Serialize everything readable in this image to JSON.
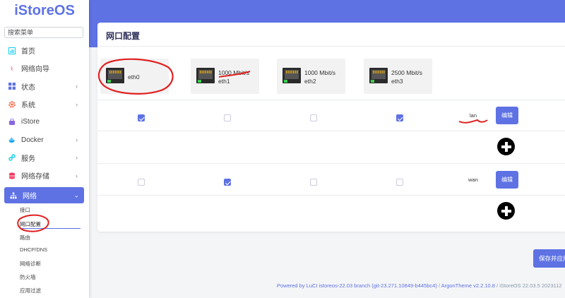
{
  "brand": {
    "title": "iStoreOS",
    "color": "#5e72e4"
  },
  "sidebar": {
    "search_placeholder": "搜索菜单",
    "items": [
      {
        "label": "首页",
        "icon": "chart-icon",
        "has_chevron": false
      },
      {
        "label": "网络向导",
        "icon": "wizard-icon",
        "has_chevron": false
      },
      {
        "label": "状态",
        "icon": "grid-icon",
        "has_chevron": true
      },
      {
        "label": "系统",
        "icon": "gear-icon",
        "has_chevron": true
      },
      {
        "label": "iStore",
        "icon": "store-icon",
        "has_chevron": false
      },
      {
        "label": "Docker",
        "icon": "docker-icon",
        "has_chevron": true
      },
      {
        "label": "服务",
        "icon": "services-icon",
        "has_chevron": true
      },
      {
        "label": "网络存储",
        "icon": "storage-icon",
        "has_chevron": true
      },
      {
        "label": "网络",
        "icon": "network-icon",
        "has_chevron": true,
        "active": true
      }
    ],
    "subitems": [
      "接口",
      "网口配置",
      "路由",
      "DHCP/DNS",
      "网络诊断",
      "防火墙",
      "应用过滤"
    ],
    "current_subitem": "网口配置"
  },
  "page": {
    "title": "网口配置"
  },
  "ports": [
    {
      "name": "eth0",
      "speed": ""
    },
    {
      "name": "eth1",
      "speed": "1000 Mbit/s"
    },
    {
      "name": "eth2",
      "speed": "1000 Mbit/s"
    },
    {
      "name": "eth3",
      "speed": "2500 Mbit/s"
    }
  ],
  "zones": [
    {
      "name": "lan",
      "members": [
        true,
        false,
        false,
        true
      ],
      "edit_label": "编辑"
    },
    {
      "name": "wan",
      "members": [
        false,
        true,
        false,
        false
      ],
      "edit_label": "编辑"
    }
  ],
  "save_label": "保存并应用",
  "footer": {
    "link": "Powered by LuCI istoreos-22.03 branch (git-23.271.10849-b445bc4)",
    "sep": " / ",
    "theme": "ArgonTheme v2.2.10.8",
    "tail": " / iStoreOS 22.03.5 2023112"
  },
  "annotation_color": "#e02020"
}
